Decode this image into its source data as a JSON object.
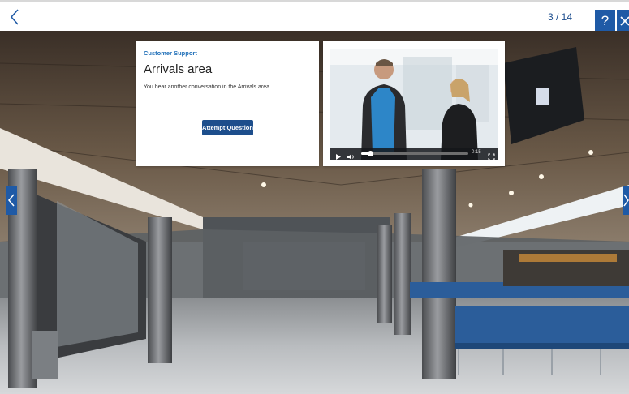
{
  "header": {
    "back_icon": "chevron-left-icon",
    "counter": "3 / 14",
    "help_label": "?",
    "close_icon": "close-icon"
  },
  "card": {
    "category": "Customer Support",
    "title": "Arrivals area",
    "description": "You hear another conversation in the Arrivals area.",
    "attempt_label": "Attempt Question"
  },
  "video": {
    "progress": 0.08,
    "time": "-0:15",
    "play_icon": "play-icon",
    "volume_icon": "volume-icon",
    "fullscreen_icon": "fullscreen-icon"
  },
  "nav": {
    "prev_icon": "chevron-left-icon",
    "next_icon": "chevron-right-icon"
  },
  "colors": {
    "accent": "#1f5aa6",
    "button": "#1d4e8c",
    "category": "#1f6fb8"
  }
}
